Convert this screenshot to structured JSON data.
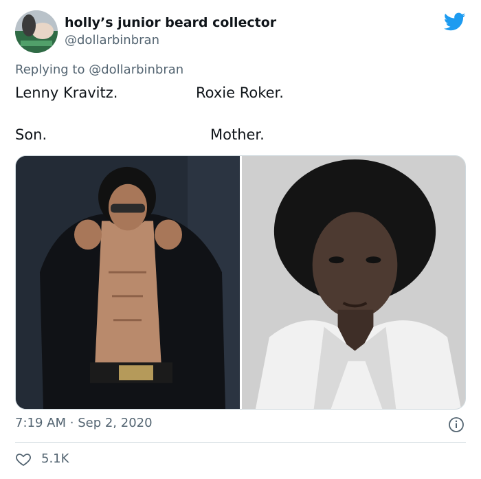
{
  "tweet": {
    "author": {
      "display_name": "holly’s junior beard collector",
      "handle": "@dollarbinbran"
    },
    "replying_to": {
      "prefix": "Replying to",
      "mention": "@dollarbinbran"
    },
    "body_lines": [
      {
        "left": "Lenny Kravitz.",
        "right": "Roxie Roker."
      },
      {
        "left": "Son.",
        "right": "Mother."
      }
    ],
    "media": [
      {
        "description_icon": "photo-man-sunglasses"
      },
      {
        "description_icon": "photo-woman-afro"
      }
    ],
    "time": "7:19 AM",
    "separator": "·",
    "date": "Sep 2, 2020",
    "likes": "5.1K"
  },
  "colors": {
    "twitter_blue": "#1d9bf0",
    "secondary_text": "#536471",
    "primary_text": "#0f1419",
    "border": "#cfd9de"
  }
}
